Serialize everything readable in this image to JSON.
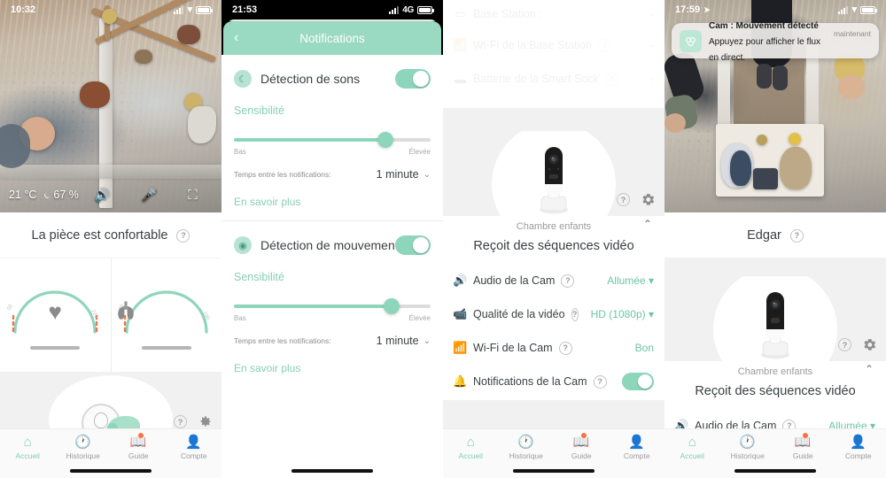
{
  "panel1": {
    "status": {
      "time": "10:32",
      "network": "",
      "icons": [
        "signal-bars",
        "wifi",
        "battery"
      ]
    },
    "video": {
      "temperature": "21 °C",
      "humidity": "67 %",
      "controls": [
        "speaker-icon",
        "microphone-icon",
        "fullscreen-icon"
      ]
    },
    "room_status": "La pièce est confortable",
    "gauges": [
      {
        "name": "heart-rate-gauge",
        "icon": "heart",
        "min_label": "50",
        "max_label": "220",
        "value": "—"
      },
      {
        "name": "oxygen-gauge",
        "icon": "lungs",
        "min_label": "80",
        "max_label": "100",
        "value": "—"
      }
    ],
    "nav": [
      {
        "label": "Accueil",
        "icon": "home-icon",
        "active": true,
        "badge": false
      },
      {
        "label": "Historique",
        "icon": "clock-icon",
        "active": false,
        "badge": false
      },
      {
        "label": "Guide",
        "icon": "book-icon",
        "active": false,
        "badge": true
      },
      {
        "label": "Compte",
        "icon": "person-icon",
        "active": false,
        "badge": false
      }
    ]
  },
  "panel2": {
    "status": {
      "time": "21:53",
      "network": "4G"
    },
    "header": {
      "title": "Notifications",
      "back": "‹"
    },
    "sections": [
      {
        "icon": "sound-detection-icon",
        "title": "Détection de sons",
        "toggle_on": true,
        "sensitivity_label": "Sensibilité",
        "slider_percent": 77,
        "slider_min": "Bas",
        "slider_max": "Élevée",
        "interval_label": "Temps entre les notifications:",
        "interval_value": "1 minute",
        "learn_more": "En savoir plus"
      },
      {
        "icon": "motion-detection-icon",
        "title": "Détection de mouvement",
        "toggle_on": true,
        "sensitivity_label": "Sensibilité",
        "slider_percent": 80,
        "slider_min": "Bas",
        "slider_max": "Élevée",
        "interval_label": "Temps entre les notifications:",
        "interval_value": "1 minute",
        "learn_more": "En savoir plus"
      }
    ]
  },
  "panel3": {
    "faded_rows": [
      {
        "icon": "base-station-icon",
        "label": "Base Station :",
        "value": "-"
      },
      {
        "icon": "wifi-icon",
        "label": "Wi-Fi de la Base Station",
        "value": "-"
      },
      {
        "icon": "battery-icon",
        "label": "Batterie de la Smart Sock",
        "value": "-"
      }
    ],
    "device": {
      "image": "camera-device",
      "name": "Chambre enfants",
      "status": "Reçoit des séquences vidéo",
      "help_icon": "question-icon",
      "settings_icon": "gear-icon",
      "collapse_icon": "chevron-up-icon"
    },
    "settings": [
      {
        "icon": "speaker-icon",
        "label": "Audio de la Cam",
        "value": "Allumée",
        "type": "dropdown"
      },
      {
        "icon": "video-icon",
        "label": "Qualité de la vidéo",
        "value": "HD (1080p)",
        "type": "dropdown"
      },
      {
        "icon": "wifi-icon",
        "label": "Wi-Fi de la Cam",
        "value": "Bon",
        "type": "text"
      },
      {
        "icon": "bell-icon",
        "label": "Notifications de la Cam",
        "value": "",
        "type": "toggle",
        "toggle_on": true
      }
    ],
    "nav": [
      {
        "label": "Accueil",
        "icon": "home-icon",
        "active": true,
        "badge": false
      },
      {
        "label": "Historique",
        "icon": "clock-icon",
        "active": false,
        "badge": false
      },
      {
        "label": "Guide",
        "icon": "book-icon",
        "active": false,
        "badge": true
      },
      {
        "label": "Compte",
        "icon": "person-icon",
        "active": false,
        "badge": false
      }
    ]
  },
  "panel4": {
    "status": {
      "time": "17:59",
      "location_arrow": "➤"
    },
    "banner": {
      "app_icon": "owlet-app-icon",
      "title": "Cam : Mouvement détecté",
      "subtitle": "Appuyez pour afficher le flux en direct.",
      "when": "maintenant"
    },
    "child_name": "Edgar",
    "device": {
      "image": "camera-device",
      "name": "Chambre enfants",
      "status": "Reçoit des séquences vidéo",
      "help_icon": "question-icon",
      "settings_icon": "gear-icon",
      "collapse_icon": "chevron-up-icon"
    },
    "settings": [
      {
        "icon": "speaker-icon",
        "label": "Audio de la Cam",
        "value": "Allumée",
        "type": "dropdown"
      }
    ],
    "nav": [
      {
        "label": "Accueil",
        "icon": "home-icon",
        "active": true,
        "badge": false
      },
      {
        "label": "Historique",
        "icon": "clock-icon",
        "active": false,
        "badge": false
      },
      {
        "label": "Guide",
        "icon": "book-icon",
        "active": false,
        "badge": true
      },
      {
        "label": "Compte",
        "icon": "person-icon",
        "active": false,
        "badge": false
      }
    ]
  },
  "theme": {
    "accent": "#8ed6bb",
    "accent_dark": "#6cc6a6",
    "header_green": "#9ad9c2",
    "badge_orange": "#ff7043",
    "text_dark": "#3c4043",
    "text_muted": "#9b9b9b"
  }
}
